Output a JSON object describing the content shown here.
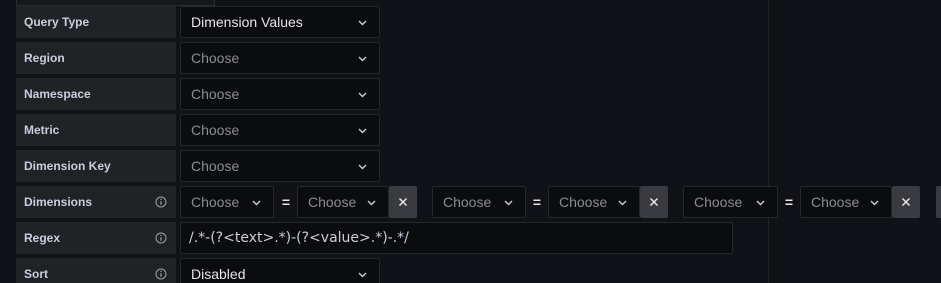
{
  "rows": {
    "query_type": {
      "label": "Query Type",
      "value": "Dimension Values"
    },
    "region": {
      "label": "Region",
      "placeholder": "Choose"
    },
    "namespace": {
      "label": "Namespace",
      "placeholder": "Choose"
    },
    "metric": {
      "label": "Metric",
      "placeholder": "Choose"
    },
    "dimension_key": {
      "label": "Dimension Key",
      "placeholder": "Choose"
    },
    "dimensions": {
      "label": "Dimensions",
      "pairs": [
        {
          "key": "Choose",
          "operator": "=",
          "value": "Choose"
        },
        {
          "key": "Choose",
          "operator": "=",
          "value": "Choose"
        },
        {
          "key": "Choose",
          "operator": "=",
          "value": "Choose"
        }
      ]
    },
    "regex": {
      "label": "Regex",
      "value": "/.*-(?<text>.*)-(?<value>.*)-.*/"
    },
    "sort": {
      "label": "Sort",
      "value": "Disabled"
    }
  },
  "icons": {
    "info": "info-circle-icon",
    "chevron": "chevron-down-icon",
    "remove": "close-icon"
  },
  "colors": {
    "background": "#111217",
    "label_bg": "#202226",
    "input_bg": "#0b0c0e",
    "remove_button": "#3a3b41"
  }
}
